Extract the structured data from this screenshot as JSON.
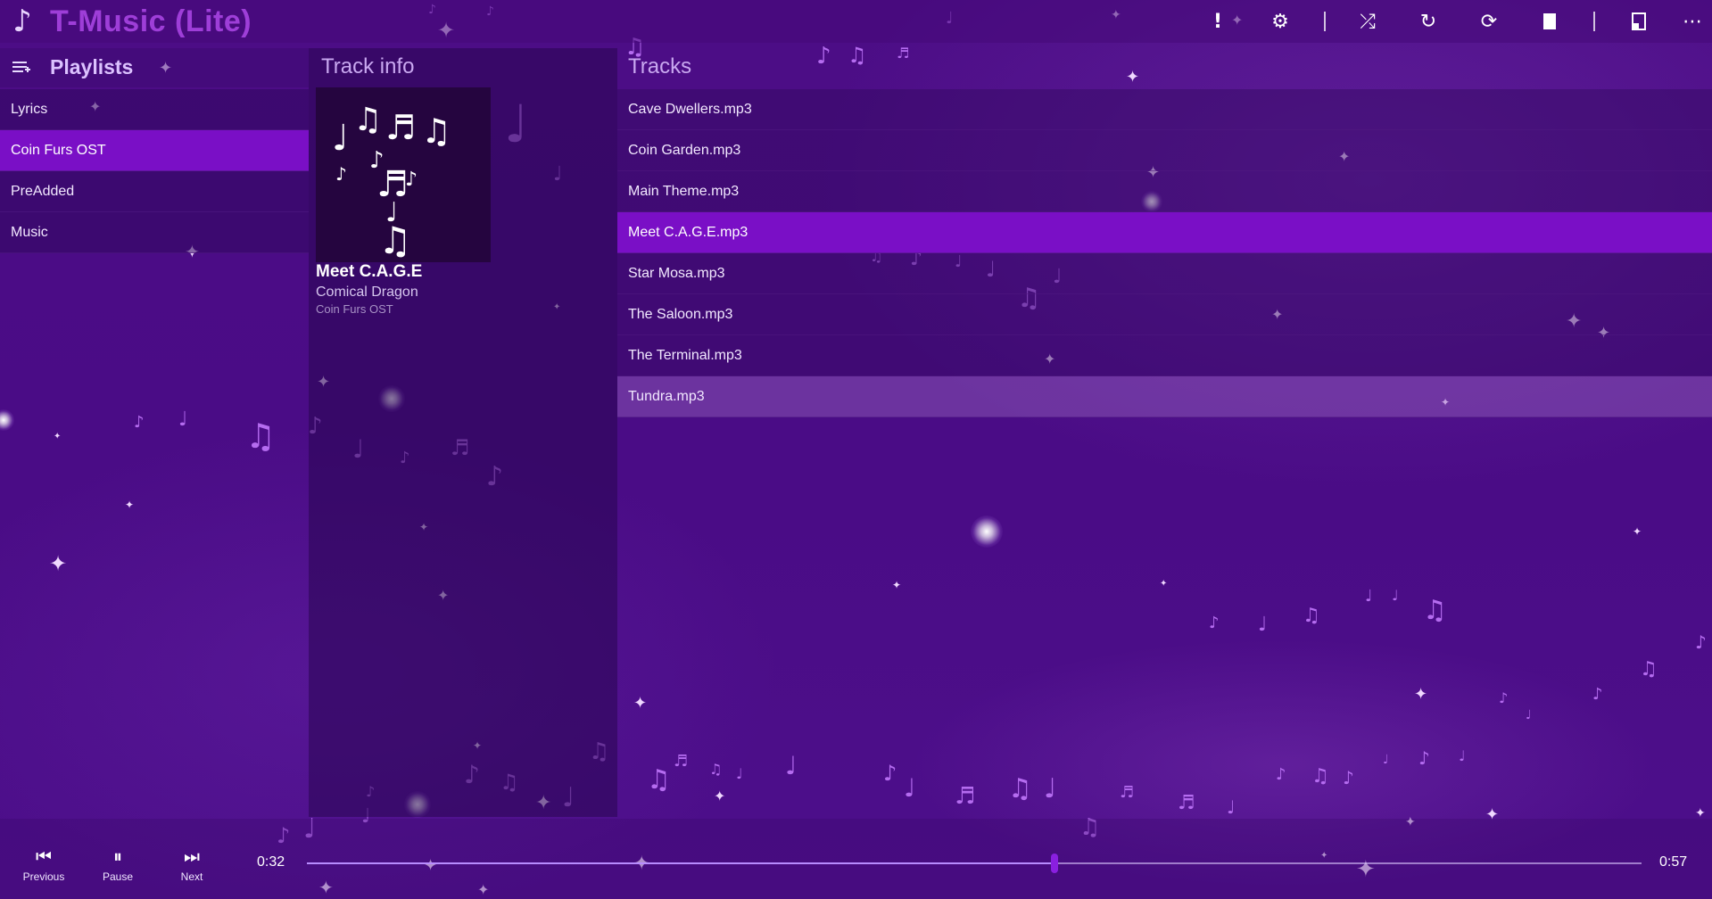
{
  "app": {
    "title": "T-Music (Lite)",
    "logo_glyph": "♪"
  },
  "toolbar": {
    "info_icon": "!",
    "settings_icon": "⚙",
    "shuffle_icon": "⤮",
    "repeat_icon": "↻",
    "repeat_one_icon": "⟳",
    "more_icon": "⋯"
  },
  "playlists": {
    "title": "Playlists",
    "items": [
      {
        "label": "Lyrics"
      },
      {
        "label": "Coin Furs OST"
      },
      {
        "label": "PreAdded"
      },
      {
        "label": "Music"
      }
    ],
    "selected_index": 1
  },
  "track_info": {
    "title": "Track info",
    "track_title": "Meet C.A.G.E",
    "artist": "Comical Dragon",
    "album": "Coin Furs OST"
  },
  "tracks": {
    "title": "Tracks",
    "items": [
      {
        "label": "Cave Dwellers.mp3"
      },
      {
        "label": "Coin Garden.mp3"
      },
      {
        "label": "Main Theme.mp3"
      },
      {
        "label": "Meet C.A.G.E.mp3"
      },
      {
        "label": "Star Mosa.mp3"
      },
      {
        "label": "The Saloon.mp3"
      },
      {
        "label": "The Terminal.mp3"
      },
      {
        "label": "Tundra.mp3"
      }
    ],
    "selected_index": 3,
    "hovered_index": 7
  },
  "player": {
    "previous_label": "Previous",
    "pause_label": "Pause",
    "next_label": "Next",
    "previous_icon": "⏮",
    "pause_icon": "⏸",
    "next_icon": "⏭",
    "current_time": "0:32",
    "total_time": "0:57",
    "progress_fraction": 0.56
  },
  "colors": {
    "background": "#4b0c87",
    "accent": "#7a0fc6",
    "title": "#9e3ed8",
    "note": "#b56cf0"
  }
}
